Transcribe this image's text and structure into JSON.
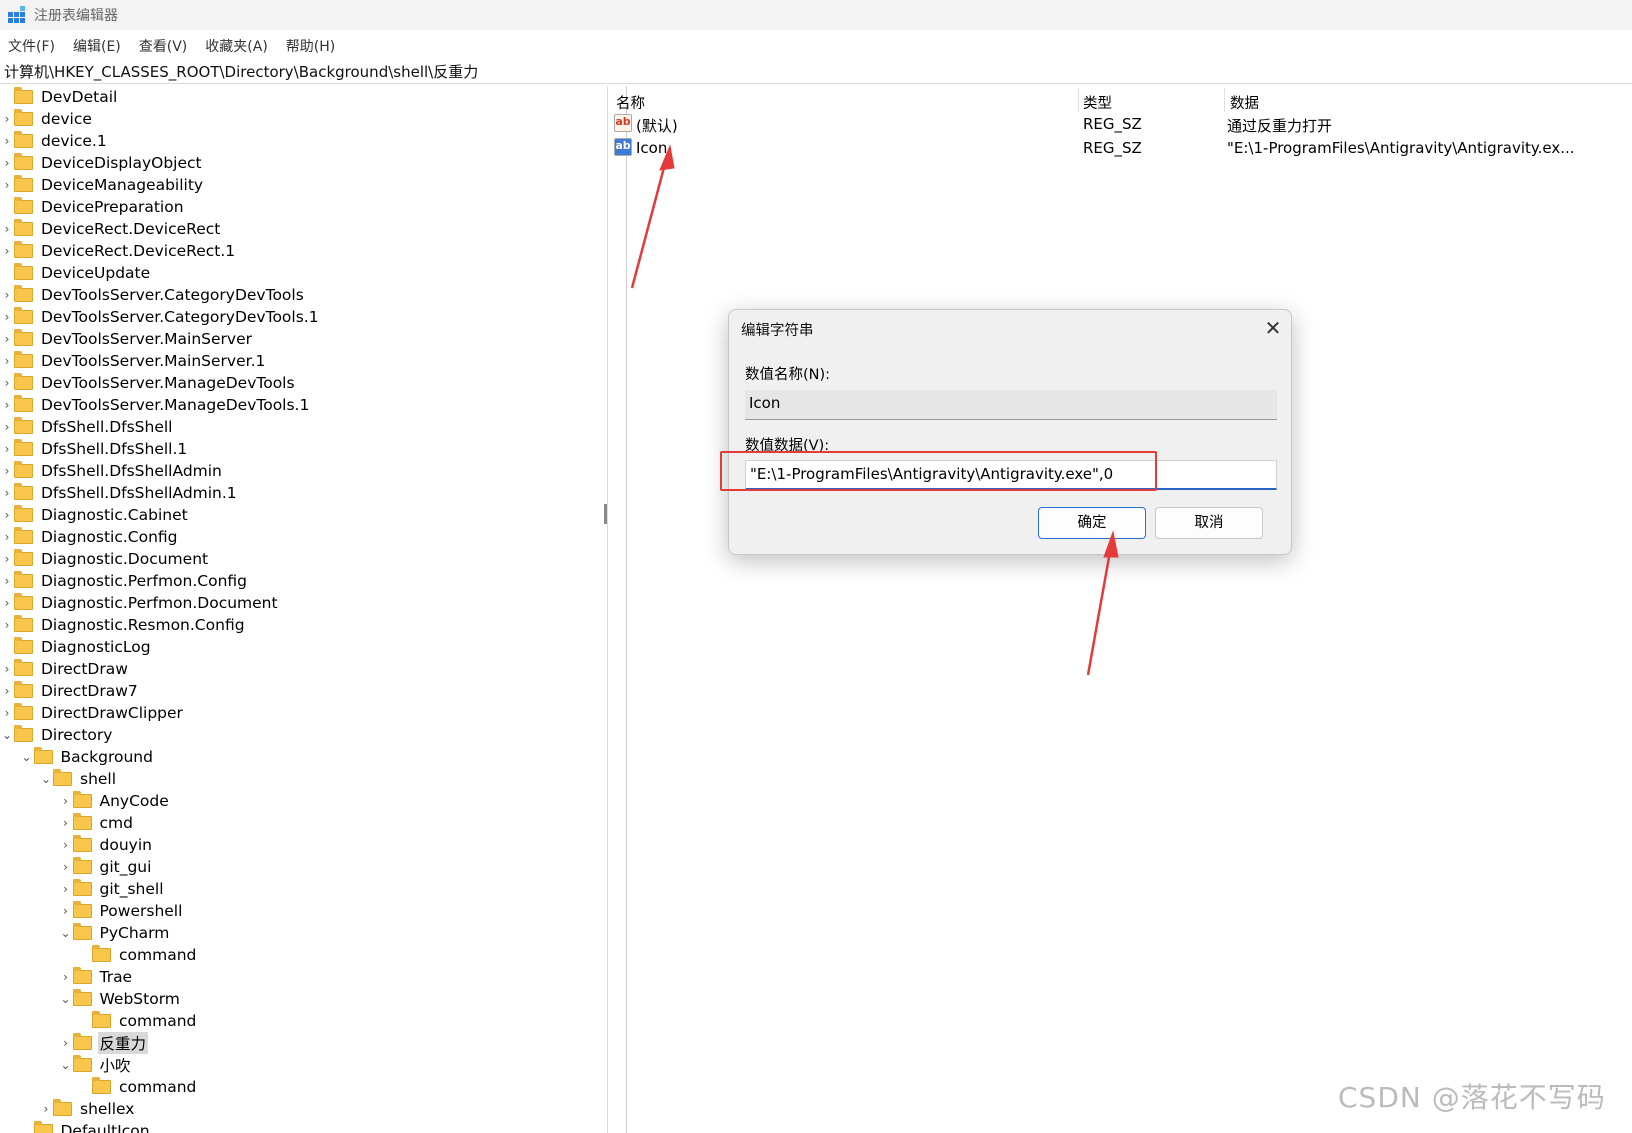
{
  "window": {
    "title": "注册表编辑器"
  },
  "menu": [
    "文件(F)",
    "编辑(E)",
    "查看(V)",
    "收藏夹(A)",
    "帮助(H)"
  ],
  "address": "计算机\\HKEY_CLASSES_ROOT\\Directory\\Background\\shell\\反重力",
  "tree": [
    {
      "label": "DevDetail",
      "level": 0,
      "state": "none"
    },
    {
      "label": "device",
      "level": 0,
      "state": "collapsed"
    },
    {
      "label": "device.1",
      "level": 0,
      "state": "collapsed"
    },
    {
      "label": "DeviceDisplayObject",
      "level": 0,
      "state": "collapsed"
    },
    {
      "label": "DeviceManageability",
      "level": 0,
      "state": "collapsed"
    },
    {
      "label": "DevicePreparation",
      "level": 0,
      "state": "none"
    },
    {
      "label": "DeviceRect.DeviceRect",
      "level": 0,
      "state": "collapsed"
    },
    {
      "label": "DeviceRect.DeviceRect.1",
      "level": 0,
      "state": "collapsed"
    },
    {
      "label": "DeviceUpdate",
      "level": 0,
      "state": "none"
    },
    {
      "label": "DevToolsServer.CategoryDevTools",
      "level": 0,
      "state": "collapsed"
    },
    {
      "label": "DevToolsServer.CategoryDevTools.1",
      "level": 0,
      "state": "collapsed"
    },
    {
      "label": "DevToolsServer.MainServer",
      "level": 0,
      "state": "collapsed"
    },
    {
      "label": "DevToolsServer.MainServer.1",
      "level": 0,
      "state": "collapsed"
    },
    {
      "label": "DevToolsServer.ManageDevTools",
      "level": 0,
      "state": "collapsed"
    },
    {
      "label": "DevToolsServer.ManageDevTools.1",
      "level": 0,
      "state": "collapsed"
    },
    {
      "label": "DfsShell.DfsShell",
      "level": 0,
      "state": "collapsed"
    },
    {
      "label": "DfsShell.DfsShell.1",
      "level": 0,
      "state": "collapsed"
    },
    {
      "label": "DfsShell.DfsShellAdmin",
      "level": 0,
      "state": "collapsed"
    },
    {
      "label": "DfsShell.DfsShellAdmin.1",
      "level": 0,
      "state": "collapsed"
    },
    {
      "label": "Diagnostic.Cabinet",
      "level": 0,
      "state": "collapsed"
    },
    {
      "label": "Diagnostic.Config",
      "level": 0,
      "state": "collapsed"
    },
    {
      "label": "Diagnostic.Document",
      "level": 0,
      "state": "collapsed"
    },
    {
      "label": "Diagnostic.Perfmon.Config",
      "level": 0,
      "state": "collapsed"
    },
    {
      "label": "Diagnostic.Perfmon.Document",
      "level": 0,
      "state": "collapsed"
    },
    {
      "label": "Diagnostic.Resmon.Config",
      "level": 0,
      "state": "collapsed"
    },
    {
      "label": "DiagnosticLog",
      "level": 0,
      "state": "none"
    },
    {
      "label": "DirectDraw",
      "level": 0,
      "state": "collapsed"
    },
    {
      "label": "DirectDraw7",
      "level": 0,
      "state": "collapsed"
    },
    {
      "label": "DirectDrawClipper",
      "level": 0,
      "state": "collapsed"
    },
    {
      "label": "Directory",
      "level": 0,
      "state": "expanded"
    },
    {
      "label": "Background",
      "level": 1,
      "state": "expanded"
    },
    {
      "label": "shell",
      "level": 2,
      "state": "expanded"
    },
    {
      "label": "AnyCode",
      "level": 3,
      "state": "collapsed"
    },
    {
      "label": "cmd",
      "level": 3,
      "state": "collapsed"
    },
    {
      "label": "douyin",
      "level": 3,
      "state": "collapsed"
    },
    {
      "label": "git_gui",
      "level": 3,
      "state": "collapsed"
    },
    {
      "label": "git_shell",
      "level": 3,
      "state": "collapsed"
    },
    {
      "label": "Powershell",
      "level": 3,
      "state": "collapsed"
    },
    {
      "label": "PyCharm",
      "level": 3,
      "state": "expanded"
    },
    {
      "label": "command",
      "level": 4,
      "state": "none"
    },
    {
      "label": "Trae",
      "level": 3,
      "state": "collapsed"
    },
    {
      "label": "WebStorm",
      "level": 3,
      "state": "expanded"
    },
    {
      "label": "command",
      "level": 4,
      "state": "none"
    },
    {
      "label": "反重力",
      "level": 3,
      "state": "collapsed",
      "selected": true
    },
    {
      "label": "小吹",
      "level": 3,
      "state": "expanded"
    },
    {
      "label": "command",
      "level": 4,
      "state": "none"
    },
    {
      "label": "shellex",
      "level": 2,
      "state": "collapsed"
    },
    {
      "label": "DefaultIcon",
      "level": 1,
      "state": "none"
    }
  ],
  "list": {
    "headers": {
      "name": "名称",
      "type": "类型",
      "data": "数据"
    },
    "rows": [
      {
        "icon": "string-value-icon",
        "name": "(默认)",
        "type": "REG_SZ",
        "data": "通过反重力打开"
      },
      {
        "icon": "string-value-icon",
        "name": "Icon",
        "type": "REG_SZ",
        "data": "\"E:\\1-ProgramFiles\\Antigravity\\Antigravity.ex..."
      }
    ]
  },
  "dialog": {
    "title": "编辑字符串",
    "name_label": "数值名称(N):",
    "name_value": "Icon",
    "data_label": "数值数据(V):",
    "data_value": "\"E:\\1-ProgramFiles\\Antigravity\\Antigravity.exe\",0",
    "ok_label": "确定",
    "cancel_label": "取消"
  },
  "annotation_color": "#e33a3a",
  "watermark": "CSDN @落花不写码"
}
